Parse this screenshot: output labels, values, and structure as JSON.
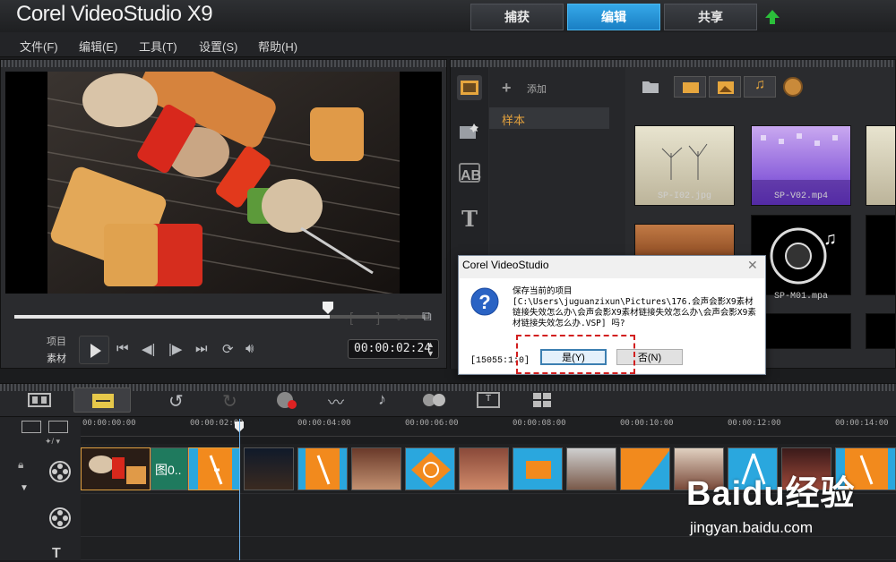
{
  "app": {
    "title": "Corel VideoStudio X9"
  },
  "mode_tabs": [
    {
      "label": "捕获"
    },
    {
      "label": "编辑",
      "active": true
    },
    {
      "label": "共享"
    }
  ],
  "menu": [
    "文件(F)",
    "编辑(E)",
    "工具(T)",
    "设置(S)",
    "帮助(H)"
  ],
  "player": {
    "project_label": "项目",
    "clip_label": "素材",
    "timecode": "00:00:02:24",
    "scrub_progress": 0.76
  },
  "library": {
    "add_label": "添加",
    "folder": "样本",
    "thumbnails": [
      {
        "label": "SP-I02.jpg"
      },
      {
        "label": "SP-V02.mp4"
      },
      {
        "label": "SP-M01.mpa"
      }
    ]
  },
  "dialog": {
    "title": "Corel VideoStudio",
    "close": "✕",
    "message": "保存当前的项目\n[C:\\Users\\juguanzixun\\Pictures\\176.会声会影X9素材链接失效怎么办\\会声会影X9素材链接失效怎么办\\会声会影X9素材链接失效怎么办.VSP] 吗?",
    "code": "[15055:1:0]",
    "yes": "是(Y)",
    "no": "否(N)"
  },
  "timeline": {
    "ticks": [
      "00:00:00:00",
      "00:00:02:00",
      "00:00:04:00",
      "00:00:06:00",
      "00:00:08:00",
      "00:00:10:00",
      "00:00:12:00",
      "00:00:14:00"
    ],
    "clip_text": "图0.."
  },
  "watermark": {
    "text": "Baidu经验",
    "url": "jingyan.baidu.com"
  },
  "colors": {
    "accent": "#1a8fd8",
    "highlight": "#d21f1f",
    "folder_text": "#e3a13d"
  }
}
